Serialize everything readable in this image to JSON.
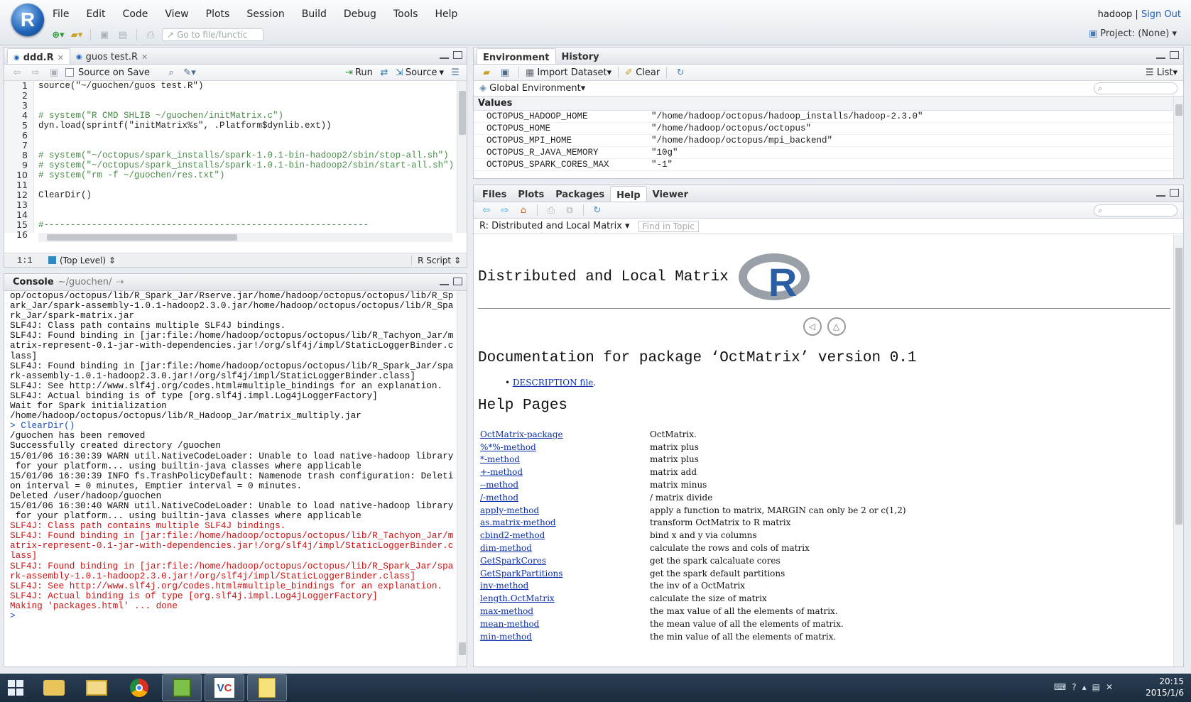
{
  "menubar": {
    "logo": "R",
    "items": [
      "File",
      "Edit",
      "Code",
      "View",
      "Plots",
      "Session",
      "Build",
      "Debug",
      "Tools",
      "Help"
    ],
    "goto_placeholder": "Go to file/functic",
    "user": "hadoop",
    "separator": "|",
    "signout": "Sign Out",
    "project": "Project: (None)"
  },
  "source": {
    "tabs": [
      {
        "label": "ddd.R"
      },
      {
        "label": "guos test.R"
      }
    ],
    "toolbar": {
      "source_on_save": "Source on Save",
      "run": "Run",
      "source": "Source"
    },
    "line_numbers": [
      "1",
      "2",
      "3",
      "4",
      "5",
      "6",
      "7",
      "8",
      "9",
      "10",
      "11",
      "12",
      "13",
      "14",
      "15",
      "16"
    ],
    "lines": [
      "source(\"~/guochen/guos test.R\")",
      "",
      "",
      "# system(\"R CMD SHLIB ~/guochen/initMatrix.c\")",
      "dyn.load(sprintf(\"initMatrix%s\", .Platform$dynlib.ext))",
      "",
      "",
      "# system(\"~/octopus/spark_installs/spark-1.0.1-bin-hadoop2/sbin/stop-all.sh\")",
      "# system(\"~/octopus/spark_installs/spark-1.0.1-bin-hadoop2/sbin/start-all.sh\")",
      "# system(\"rm -f ~/guochen/res.txt\")",
      "",
      "ClearDir()",
      "",
      "",
      "#-------------------------------------------------------------",
      ""
    ],
    "status": {
      "position": "1:1",
      "scope": "(Top Level)",
      "type": "R Script"
    }
  },
  "console": {
    "title": "Console",
    "path": "~/guochen/",
    "lines": [
      {
        "t": "op/octopus/octopus/lib/R_Spark_Jar/Rserve.jar/home/hadoop/octopus/octopus/lib/R_Sp",
        "c": "out"
      },
      {
        "t": "ark_Jar/spark-assembly-1.0.1-hadoop2.3.0.jar/home/hadoop/octopus/octopus/lib/R_Spa",
        "c": "out"
      },
      {
        "t": "rk_Jar/spark-matrix.jar",
        "c": "out"
      },
      {
        "t": "",
        "c": "out"
      },
      {
        "t": "SLF4J: Class path contains multiple SLF4J bindings.",
        "c": "out"
      },
      {
        "t": "SLF4J: Found binding in [jar:file:/home/hadoop/octopus/octopus/lib/R_Tachyon_Jar/m",
        "c": "out"
      },
      {
        "t": "atrix-represent-0.1-jar-with-dependencies.jar!/org/slf4j/impl/StaticLoggerBinder.c",
        "c": "out"
      },
      {
        "t": "lass]",
        "c": "out"
      },
      {
        "t": "SLF4J: Found binding in [jar:file:/home/hadoop/octopus/octopus/lib/R_Spark_Jar/spa",
        "c": "out"
      },
      {
        "t": "rk-assembly-1.0.1-hadoop2.3.0.jar!/org/slf4j/impl/StaticLoggerBinder.class]",
        "c": "out"
      },
      {
        "t": "SLF4J: See http://www.slf4j.org/codes.html#multiple_bindings for an explanation.",
        "c": "out"
      },
      {
        "t": "SLF4J: Actual binding is of type [org.slf4j.impl.Log4jLoggerFactory]",
        "c": "out"
      },
      {
        "t": "Wait for Spark initialization",
        "c": "out"
      },
      {
        "t": "",
        "c": "out"
      },
      {
        "t": "/home/hadoop/octopus/octopus/lib/R_Hadoop_Jar/matrix_multiply.jar",
        "c": "out"
      },
      {
        "t": "> ClearDir()",
        "c": "cmd"
      },
      {
        "t": "/guochen has been removed",
        "c": "out"
      },
      {
        "t": "Successfully created directory /guochen",
        "c": "out"
      },
      {
        "t": "15/01/06 16:30:39 WARN util.NativeCodeLoader: Unable to load native-hadoop library",
        "c": "out"
      },
      {
        "t": " for your platform... using builtin-java classes where applicable",
        "c": "out"
      },
      {
        "t": "15/01/06 16:30:39 INFO fs.TrashPolicyDefault: Namenode trash configuration: Deleti",
        "c": "out"
      },
      {
        "t": "on interval = 0 minutes, Emptier interval = 0 minutes.",
        "c": "out"
      },
      {
        "t": "Deleted /user/hadoop/guochen",
        "c": "out"
      },
      {
        "t": "15/01/06 16:30:40 WARN util.NativeCodeLoader: Unable to load native-hadoop library",
        "c": "out"
      },
      {
        "t": " for your platform... using builtin-java classes where applicable",
        "c": "out"
      },
      {
        "t": "SLF4J: Class path contains multiple SLF4J bindings.",
        "c": "err"
      },
      {
        "t": "SLF4J: Found binding in [jar:file:/home/hadoop/octopus/octopus/lib/R_Tachyon_Jar/m",
        "c": "err"
      },
      {
        "t": "atrix-represent-0.1-jar-with-dependencies.jar!/org/slf4j/impl/StaticLoggerBinder.c",
        "c": "err"
      },
      {
        "t": "lass]",
        "c": "err"
      },
      {
        "t": "SLF4J: Found binding in [jar:file:/home/hadoop/octopus/octopus/lib/R_Spark_Jar/spa",
        "c": "err"
      },
      {
        "t": "rk-assembly-1.0.1-hadoop2.3.0.jar!/org/slf4j/impl/StaticLoggerBinder.class]",
        "c": "err"
      },
      {
        "t": "SLF4J: See http://www.slf4j.org/codes.html#multiple_bindings for an explanation.",
        "c": "err"
      },
      {
        "t": "SLF4J: Actual binding is of type [org.slf4j.impl.Log4jLoggerFactory]",
        "c": "err"
      },
      {
        "t": "Making 'packages.html' ... done",
        "c": "err"
      },
      {
        "t": "> ",
        "c": "cmd"
      }
    ]
  },
  "environment": {
    "tabs": [
      "Environment",
      "History"
    ],
    "toolbar": {
      "import": "Import Dataset",
      "clear": "Clear",
      "view": "List"
    },
    "scope": "Global Environment",
    "section": "Values",
    "rows": [
      {
        "name": "OCTOPUS_HADOOP_HOME",
        "value": "\"/home/hadoop/octopus/hadoop_installs/hadoop-2.3.0\""
      },
      {
        "name": "OCTOPUS_HOME",
        "value": "\"/home/hadoop/octopus/octopus\""
      },
      {
        "name": "OCTOPUS_MPI_HOME",
        "value": "\"/home/hadoop/octopus/mpi_backend\""
      },
      {
        "name": "OCTOPUS_R_JAVA_MEMORY",
        "value": "\"10g\""
      },
      {
        "name": "OCTOPUS_SPARK_CORES_MAX",
        "value": "\"-1\""
      }
    ]
  },
  "help": {
    "tabs": [
      "Files",
      "Plots",
      "Packages",
      "Help",
      "Viewer"
    ],
    "topic": "R: Distributed and Local Matrix",
    "find_placeholder": "Find in Topic",
    "title": "Distributed and Local Matrix",
    "doc_title": "Documentation for package ‘OctMatrix’ version 0.1",
    "description_link": "DESCRIPTION file",
    "pages_heading": "Help Pages",
    "entries": [
      {
        "k": "OctMatrix-package",
        "d": "OctMatrix."
      },
      {
        "k": "%*%-method",
        "d": "matrix plus"
      },
      {
        "k": "*-method",
        "d": "matrix plus"
      },
      {
        "k": "+-method",
        "d": "matrix add"
      },
      {
        "k": "--method",
        "d": "matrix minus"
      },
      {
        "k": "/-method",
        "d": "/ matrix divide"
      },
      {
        "k": "apply-method",
        "d": "apply a function to matrix, MARGIN can only be 2 or c(1,2)"
      },
      {
        "k": "as.matrix-method",
        "d": "transform OctMatrix to R matrix"
      },
      {
        "k": "cbind2-method",
        "d": "bind x and y via columns"
      },
      {
        "k": "dim-method",
        "d": "calculate the rows and cols of matrix"
      },
      {
        "k": "GetSparkCores",
        "d": "get the spark calcaluate cores"
      },
      {
        "k": "GetSparkPartitions",
        "d": "get the spark default partitions"
      },
      {
        "k": "inv-method",
        "d": "the inv of a OctMatrix"
      },
      {
        "k": "length.OctMatrix",
        "d": "calculate the size of matrix"
      },
      {
        "k": "max-method",
        "d": "the max value of all the elements of matrix."
      },
      {
        "k": "mean-method",
        "d": "the mean value of all the elements of matrix."
      },
      {
        "k": "min-method",
        "d": "the min value of all the elements of matrix."
      }
    ]
  },
  "taskbar": {
    "time": "20:15",
    "date": "2015/1/6"
  }
}
